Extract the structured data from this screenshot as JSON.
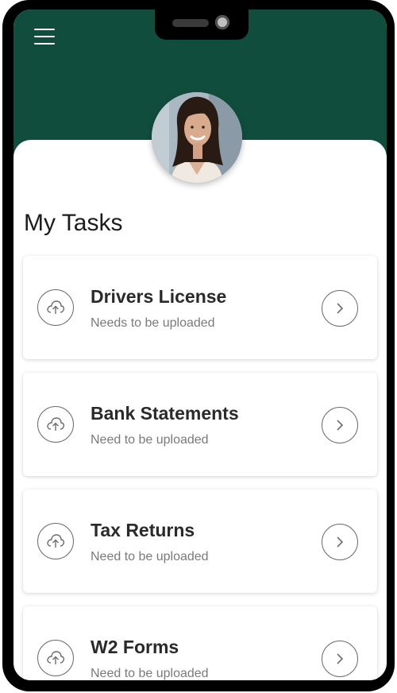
{
  "colors": {
    "header_bg": "#114d3d",
    "card_bg": "#ffffff",
    "icon_stroke": "#6e6e6e"
  },
  "header": {
    "menu_icon": "hamburger-menu-icon"
  },
  "profile": {
    "avatar": "user-avatar-photo"
  },
  "page": {
    "title": "My Tasks"
  },
  "tasks": [
    {
      "title": "Drivers License",
      "status": "Needs to be uploaded",
      "icon": "cloud-upload-icon",
      "action_icon": "chevron-right-icon"
    },
    {
      "title": "Bank Statements",
      "status": "Need to be uploaded",
      "icon": "cloud-upload-icon",
      "action_icon": "chevron-right-icon"
    },
    {
      "title": "Tax Returns",
      "status": "Need to be uploaded",
      "icon": "cloud-upload-icon",
      "action_icon": "chevron-right-icon"
    },
    {
      "title": "W2 Forms",
      "status": "Need to be uploaded",
      "icon": "cloud-upload-icon",
      "action_icon": "chevron-right-icon"
    }
  ]
}
